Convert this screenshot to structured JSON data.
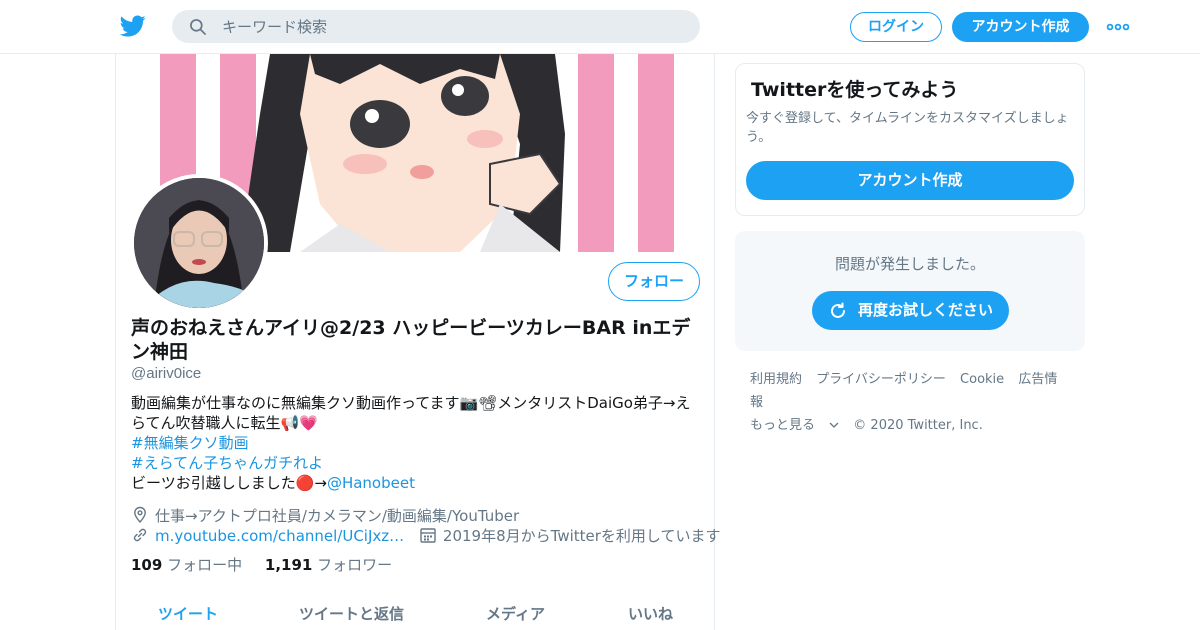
{
  "header": {
    "search_placeholder": "キーワード検索",
    "login_label": "ログイン",
    "signup_label": "アカウント作成",
    "brand_color": "#1da1f2"
  },
  "profile": {
    "follow_label": "フォロー",
    "name": "声のおねえさんアイリ@2/23 ハッピービーツカレーBAR inエデン神田",
    "handle": "@airiv0ice",
    "bio_line1": "動画編集が仕事なのに無編集クソ動画作ってます📷📽メンタリストDaiGo弟子→えらてん吹替職人に転生📢💗",
    "bio_tag1": "#無編集クソ動画",
    "bio_tag2": "#えらてん子ちゃんガチれよ",
    "bio_line4_text": "ビーツお引越ししました🔴→",
    "bio_mention": "@Hanobeet",
    "location": "仕事→アクトプロ社員/カメラマン/動画編集/YouTuber",
    "url": "m.youtube.com/channel/UCiJxz…",
    "joined": "2019年8月からTwitterを利用しています",
    "following_count": "109",
    "following_label": "フォロー中",
    "followers_count": "1,191",
    "followers_label": "フォロワー"
  },
  "tabs": [
    {
      "label": "ツイート",
      "active": true
    },
    {
      "label": "ツイートと返信",
      "active": false
    },
    {
      "label": "メディア",
      "active": false
    },
    {
      "label": "いいね",
      "active": false
    }
  ],
  "signup_card": {
    "title": "Twitterを使ってみよう",
    "text": "今すぐ登録して、タイムラインをカスタマイズしましょう。",
    "button": "アカウント作成"
  },
  "error_card": {
    "message": "問題が発生しました。",
    "retry": "再度お試しください"
  },
  "footer": {
    "links": [
      "利用規約",
      "プライバシーポリシー",
      "Cookie",
      "広告情報"
    ],
    "more": "もっと見る",
    "copyright": "© 2020 Twitter, Inc."
  }
}
